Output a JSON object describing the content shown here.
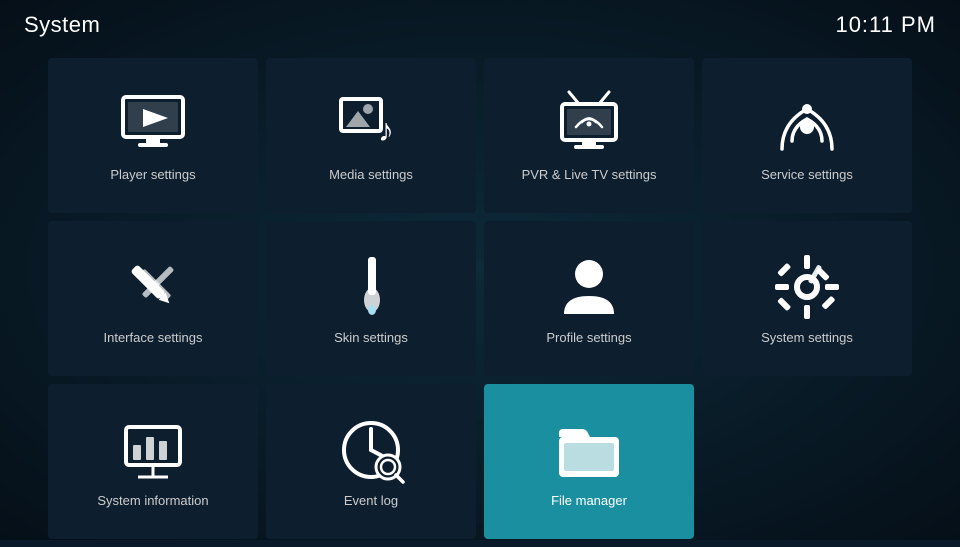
{
  "header": {
    "title": "System",
    "time": "10:11 PM"
  },
  "tiles": [
    {
      "id": "player-settings",
      "label": "Player settings",
      "icon": "player",
      "active": false
    },
    {
      "id": "media-settings",
      "label": "Media settings",
      "icon": "media",
      "active": false
    },
    {
      "id": "pvr-settings",
      "label": "PVR & Live TV settings",
      "icon": "pvr",
      "active": false
    },
    {
      "id": "service-settings",
      "label": "Service settings",
      "icon": "service",
      "active": false
    },
    {
      "id": "interface-settings",
      "label": "Interface settings",
      "icon": "interface",
      "active": false
    },
    {
      "id": "skin-settings",
      "label": "Skin settings",
      "icon": "skin",
      "active": false
    },
    {
      "id": "profile-settings",
      "label": "Profile settings",
      "icon": "profile",
      "active": false
    },
    {
      "id": "system-settings",
      "label": "System settings",
      "icon": "system",
      "active": false
    },
    {
      "id": "system-information",
      "label": "System information",
      "icon": "sysinfo",
      "active": false
    },
    {
      "id": "event-log",
      "label": "Event log",
      "icon": "eventlog",
      "active": false
    },
    {
      "id": "file-manager",
      "label": "File manager",
      "icon": "filemanager",
      "active": true
    }
  ]
}
